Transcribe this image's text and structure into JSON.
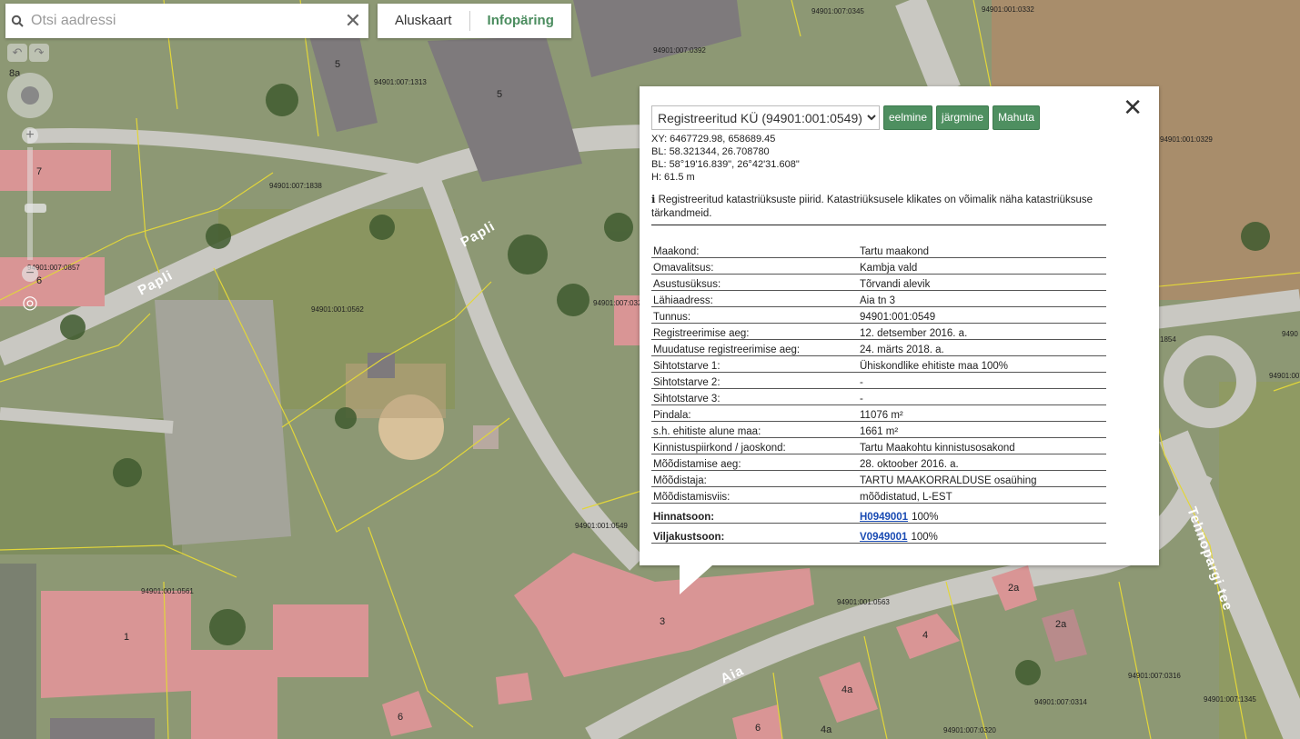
{
  "search": {
    "placeholder": "Otsi aadressi",
    "clear_glyph": "✕",
    "icon": "search-icon"
  },
  "mode_tabs": [
    {
      "label": "Aluskaart",
      "active": false
    },
    {
      "label": "Infopäring",
      "active": true
    }
  ],
  "colors": {
    "accent": "#4a8c5e",
    "button_green": "#4e8f60",
    "link": "#1a4bb3"
  },
  "map": {
    "streets": [
      "Papli",
      "Papli",
      "Papli",
      "Aia",
      "Tehnopargi tee"
    ],
    "parcels": [
      "94901:007:1313",
      "94901:007:0392",
      "94901:007:0345",
      "94901:001:0332",
      "94901:007:1838",
      "94901:007:0857",
      "94901:001:0562",
      "94901:007:032",
      "94901:001:0549",
      "94901:001:0561",
      "94901:001:0563",
      "94901:007:0316",
      "94901:007:0314",
      "94901:007:1345",
      "94901:007:0320",
      "94901:007:0320",
      "1854",
      "9490",
      "94901:007:",
      "94901:001:0329"
    ],
    "buildings": [
      "5",
      "5",
      "7",
      "6",
      "1",
      "3",
      "2a",
      "2a",
      "4",
      "4a",
      "6",
      "8a",
      "6",
      "4a"
    ]
  },
  "popup": {
    "layer_select": "Registreeritud KÜ (94901:001:0549)",
    "buttons": {
      "prev": "eelmine",
      "next": "järgmine",
      "clear": "Mahuta"
    },
    "close_glyph": "✕",
    "coords": [
      "XY: 6467729.98, 658689.45",
      "BL: 58.321344, 26.708780",
      "BL: 58°19'16.839\", 26°42'31.608\"",
      "H: 61.5 m"
    ],
    "info_icon": "ℹ",
    "info_text": "Registreeritud katastriüksuste piirid. Katastriüksusele klikates on võimalik näha katastriüksuse tärkandmeid.",
    "rows": [
      {
        "key": "Maakond:",
        "value": "Tartu maakond"
      },
      {
        "key": "Omavalitsus:",
        "value": "Kambja vald"
      },
      {
        "key": "Asustusüksus:",
        "value": "Tõrvandi alevik"
      },
      {
        "key": "Lähiaadress:",
        "value": "Aia tn 3"
      },
      {
        "key": "Tunnus:",
        "value": "94901:001:0549"
      },
      {
        "key": "Registreerimise aeg:",
        "value": "12. detsember 2016. a."
      },
      {
        "key": "Muudatuse registreerimise aeg:",
        "value": "24. märts 2018. a."
      },
      {
        "key": "Sihtotstarve 1:",
        "value": "Ühiskondlike ehitiste maa 100%"
      },
      {
        "key": "Sihtotstarve 2:",
        "value": "-"
      },
      {
        "key": "Sihtotstarve 3:",
        "value": "-"
      },
      {
        "key": "Pindala:",
        "value": "11076 m²"
      },
      {
        "key": "s.h. ehitiste alune maa:",
        "value": "1661 m²"
      },
      {
        "key": "Kinnistuspiirkond / jaoskond:",
        "value": "Tartu Maakohtu kinnistusosakond"
      },
      {
        "key": "Mõõdistamise aeg:",
        "value": "28. oktoober 2016. a."
      },
      {
        "key": "Mõõdistaja:",
        "value": "TARTU MAAKORRALDUSE osaühing"
      },
      {
        "key": "Mõõdistamisviis:",
        "value": "mõõdistatud, L-EST"
      }
    ],
    "link_rows": [
      {
        "key": "Hinnatsoon:",
        "link": "H0949001",
        "suffix": "100%"
      },
      {
        "key": "Viljakustsoon:",
        "link": "V0949001",
        "suffix": "100%"
      }
    ]
  }
}
